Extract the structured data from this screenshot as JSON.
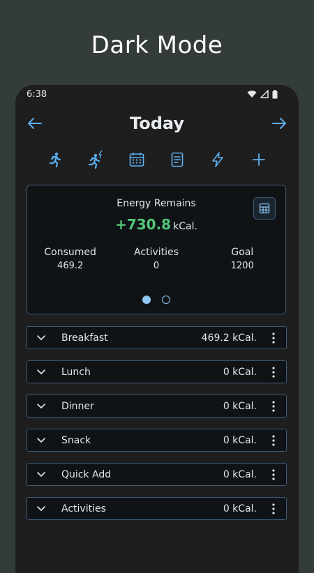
{
  "banner": {
    "title": "Dark Mode"
  },
  "status_bar": {
    "time": "6:38"
  },
  "header": {
    "title": "Today"
  },
  "toolbar": {
    "icons": [
      "runner-icon",
      "runner-bolt-icon",
      "calendar-icon",
      "document-icon",
      "bolt-icon",
      "plus-icon"
    ]
  },
  "summary": {
    "title": "Energy Remains",
    "value": "+730.8",
    "unit": "kCal.",
    "stats": [
      {
        "label": "Consumed",
        "value": "469.2"
      },
      {
        "label": "Activities",
        "value": "0"
      },
      {
        "label": "Goal",
        "value": "1200"
      }
    ],
    "pager": {
      "pages": 2,
      "active": 1
    }
  },
  "meals": [
    {
      "name": "Breakfast",
      "kcal": "469.2 kCal."
    },
    {
      "name": "Lunch",
      "kcal": "0 kCal."
    },
    {
      "name": "Dinner",
      "kcal": "0 kCal."
    },
    {
      "name": "Snack",
      "kcal": "0 kCal."
    },
    {
      "name": "Quick Add",
      "kcal": "0 kCal."
    },
    {
      "name": "Activities",
      "kcal": "0 kCal."
    }
  ],
  "colors": {
    "accent": "#5db0f0",
    "positive": "#52c77a",
    "border": "#3c5a78",
    "background": "#1e1e1f"
  }
}
